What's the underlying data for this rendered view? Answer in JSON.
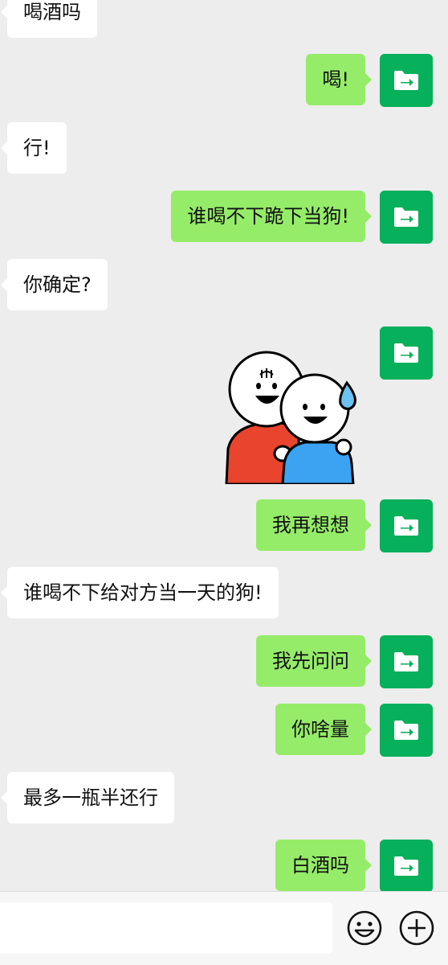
{
  "messages": [
    {
      "side": "left",
      "text": "喝酒吗"
    },
    {
      "side": "right",
      "text": "喝!",
      "avatar_icon": "folder-arrow-icon"
    },
    {
      "side": "left",
      "text": "行!"
    },
    {
      "side": "right",
      "text": "谁喝不下跪下当狗!",
      "avatar_icon": "folder-arrow-icon"
    },
    {
      "side": "left",
      "text": "你确定?"
    },
    {
      "side": "right",
      "type": "sticker",
      "sticker_icon": "two-friends-sticker",
      "avatar_icon": "folder-arrow-icon"
    },
    {
      "side": "right",
      "text": "我再想想",
      "avatar_icon": "folder-arrow-icon"
    },
    {
      "side": "left",
      "text": "谁喝不下给对方当一天的狗!"
    },
    {
      "side": "right",
      "text": "我先问问",
      "avatar_icon": "folder-arrow-icon"
    },
    {
      "side": "right",
      "text": "你啥量",
      "avatar_icon": "folder-arrow-icon"
    },
    {
      "side": "left",
      "text": "最多一瓶半还行"
    },
    {
      "side": "right",
      "text": "白酒吗",
      "avatar_icon": "folder-arrow-icon"
    }
  ],
  "input_bar": {
    "text_value": "",
    "emoji_icon": "emoji-smile-icon",
    "plus_icon": "plus-circle-icon"
  },
  "colors": {
    "background": "#ededed",
    "outgoing_bubble": "#95ec69",
    "incoming_bubble": "#ffffff",
    "avatar": "#07b05a"
  }
}
